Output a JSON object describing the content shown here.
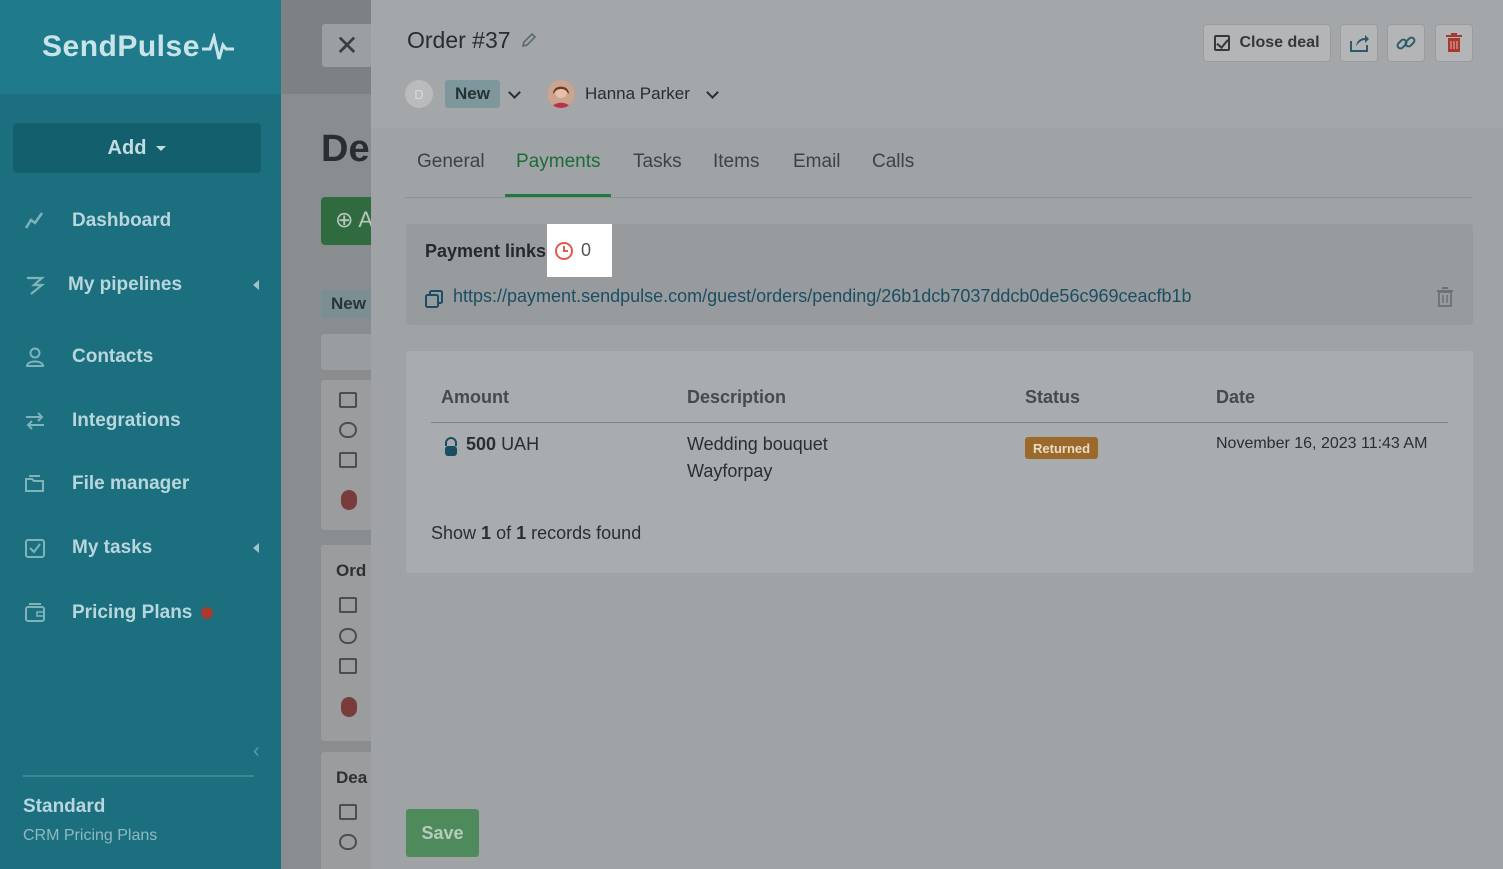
{
  "sidebar": {
    "logo": "SendPulse",
    "add_label": "Add",
    "items": [
      {
        "label": "Dashboard",
        "icon": "chart-line-icon"
      },
      {
        "label": "My pipelines",
        "icon": "pipeline-icon"
      },
      {
        "label": "Contacts",
        "icon": "contacts-icon"
      },
      {
        "label": "Integrations",
        "icon": "integrations-icon"
      },
      {
        "label": "File manager",
        "icon": "folder-icon"
      },
      {
        "label": "My tasks",
        "icon": "task-check-icon"
      },
      {
        "label": "Pricing Plans",
        "icon": "wallet-icon"
      }
    ],
    "plan_title": "Standard",
    "plan_subtitle": "CRM Pricing Plans"
  },
  "background": {
    "title": "De",
    "button": "⊕ A",
    "stage": "New",
    "cards": [
      "Ord",
      "Dea"
    ]
  },
  "deal": {
    "title": "Order #37",
    "avatar_initial": "D",
    "stage": "New",
    "owner": "Hanna Parker",
    "close_deal_label": "Close deal"
  },
  "tabs": [
    "General",
    "Payments",
    "Tasks",
    "Items",
    "Email",
    "Calls"
  ],
  "active_tab": "Payments",
  "payment_links": {
    "label": "Payment links",
    "count": "0",
    "url": "https://payment.sendpulse.com/guest/orders/pending/26b1dcb7037ddcb0de56c969ceacfb1b"
  },
  "payments_table": {
    "headers": [
      "Amount",
      "Description",
      "Status",
      "Date"
    ],
    "rows": [
      {
        "amount": "500",
        "currency": "UAH",
        "description_line1": "Wedding bouquet",
        "description_line2": "Wayforpay",
        "status": "Returned",
        "date": "November 16, 2023 11:43 AM"
      }
    ],
    "records_prefix": "Show",
    "records_shown": "1",
    "records_of": "of",
    "records_total": "1",
    "records_suffix": "records found"
  },
  "save_label": "Save",
  "colors": {
    "sidebar": "#1b6f7f",
    "accent_green": "#1f7a40",
    "returned_badge": "#9b6a2a",
    "clock_red": "#e05a4e"
  }
}
